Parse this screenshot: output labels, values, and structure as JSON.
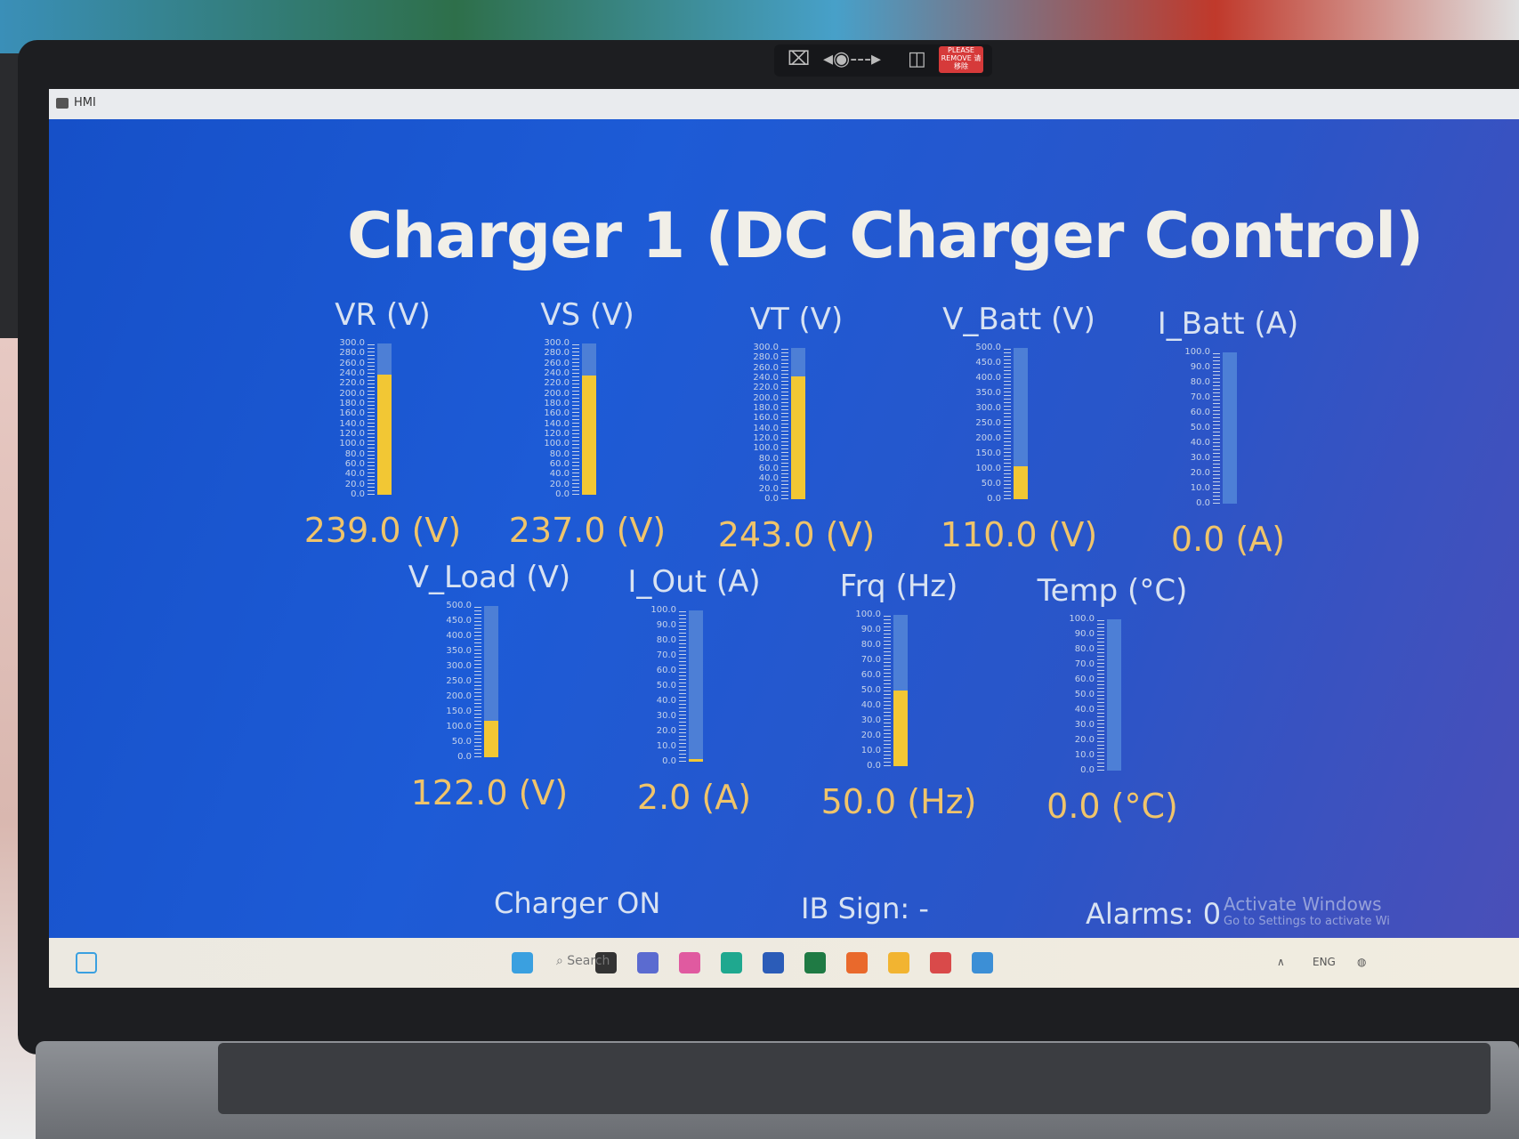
{
  "window": {
    "title": "HMI"
  },
  "header": {
    "title": "Charger 1 (DC Charger Control)"
  },
  "camera": {
    "privacy_label": "PLEASE REMOVE 请移除"
  },
  "gauges": [
    {
      "label": "VR (V)",
      "min": 0,
      "max": 300,
      "value": 239.0,
      "value_text": "239.0 (V)",
      "ticks": [
        "300.0",
        "280.0",
        "260.0",
        "240.0",
        "220.0",
        "200.0",
        "180.0",
        "160.0",
        "140.0",
        "120.0",
        "100.0",
        "80.0",
        "60.0",
        "40.0",
        "20.0",
        "0.0"
      ]
    },
    {
      "label": "VS (V)",
      "min": 0,
      "max": 300,
      "value": 237.0,
      "value_text": "237.0 (V)",
      "ticks": [
        "300.0",
        "280.0",
        "260.0",
        "240.0",
        "220.0",
        "200.0",
        "180.0",
        "160.0",
        "140.0",
        "120.0",
        "100.0",
        "80.0",
        "60.0",
        "40.0",
        "20.0",
        "0.0"
      ]
    },
    {
      "label": "VT (V)",
      "min": 0,
      "max": 300,
      "value": 243.0,
      "value_text": "243.0 (V)",
      "ticks": [
        "300.0",
        "280.0",
        "260.0",
        "240.0",
        "220.0",
        "200.0",
        "180.0",
        "160.0",
        "140.0",
        "120.0",
        "100.0",
        "80.0",
        "60.0",
        "40.0",
        "20.0",
        "0.0"
      ]
    },
    {
      "label": "V_Batt (V)",
      "min": 0,
      "max": 500,
      "value": 110.0,
      "value_text": "110.0 (V)",
      "ticks": [
        "500.0",
        "450.0",
        "400.0",
        "350.0",
        "300.0",
        "250.0",
        "200.0",
        "150.0",
        "100.0",
        "50.0",
        "0.0"
      ]
    },
    {
      "label": "I_Batt (A)",
      "min": 0,
      "max": 100,
      "value": 0.0,
      "value_text": "0.0 (A)",
      "ticks": [
        "100.0",
        "90.0",
        "80.0",
        "70.0",
        "60.0",
        "50.0",
        "40.0",
        "30.0",
        "20.0",
        "10.0",
        "0.0"
      ]
    },
    {
      "label": "V_Load (V)",
      "min": 0,
      "max": 500,
      "value": 122.0,
      "value_text": "122.0 (V)",
      "ticks": [
        "500.0",
        "450.0",
        "400.0",
        "350.0",
        "300.0",
        "250.0",
        "200.0",
        "150.0",
        "100.0",
        "50.0",
        "0.0"
      ]
    },
    {
      "label": "I_Out (A)",
      "min": 0,
      "max": 100,
      "value": 2.0,
      "value_text": "2.0 (A)",
      "ticks": [
        "100.0",
        "90.0",
        "80.0",
        "70.0",
        "60.0",
        "50.0",
        "40.0",
        "30.0",
        "20.0",
        "10.0",
        "0.0"
      ]
    },
    {
      "label": "Frq (Hz)",
      "min": 0,
      "max": 100,
      "value": 50.0,
      "value_text": "50.0 (Hz)",
      "ticks": [
        "100.0",
        "90.0",
        "80.0",
        "70.0",
        "60.0",
        "50.0",
        "40.0",
        "30.0",
        "20.0",
        "10.0",
        "0.0"
      ]
    },
    {
      "label": "Temp (°C)",
      "min": 0,
      "max": 100,
      "value": 0.0,
      "value_text": "0.0 (°C)",
      "ticks": [
        "100.0",
        "90.0",
        "80.0",
        "70.0",
        "60.0",
        "50.0",
        "40.0",
        "30.0",
        "20.0",
        "10.0",
        "0.0"
      ]
    }
  ],
  "status": {
    "charger": "Charger ON",
    "ib_sign": "IB Sign: -",
    "alarms": "Alarms: 0"
  },
  "watermark": {
    "title": "Activate Windows",
    "subtitle": "Go to Settings to activate Wi"
  },
  "taskbar": {
    "search_placeholder": "Search",
    "language": "ENG",
    "icons": [
      "windows-start-icon",
      "search-icon",
      "file-explorer-icon",
      "teams-icon",
      "copilot-icon",
      "edge-icon",
      "word-icon",
      "excel-icon",
      "firefox-icon",
      "folder-icon",
      "app-icon",
      "hmi-app-icon"
    ],
    "icon_colors": [
      "#3aa0e0",
      "#777777",
      "#333333",
      "#5b6bd0",
      "#e05aa0",
      "#1fa88f",
      "#2b5cb8",
      "#1f7a44",
      "#e9692c",
      "#f2b431",
      "#d94a4a",
      "#3c8fd6"
    ]
  }
}
